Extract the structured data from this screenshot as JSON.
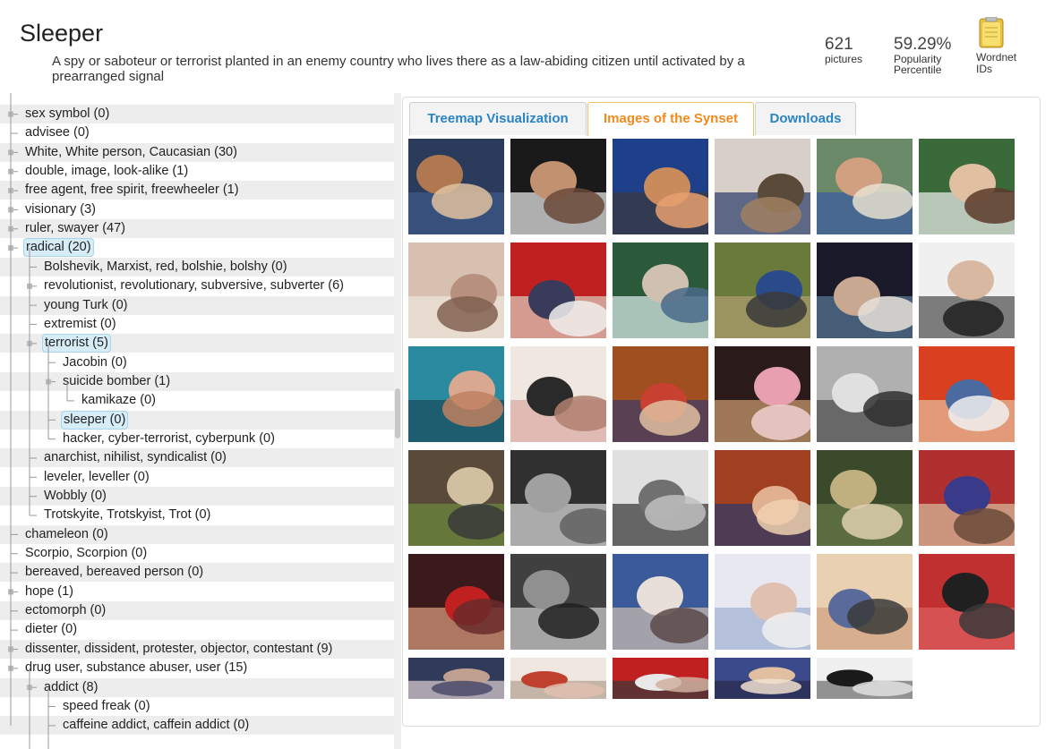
{
  "header": {
    "title": "Sleeper",
    "gloss": "A spy or saboteur or terrorist planted in an enemy country who lives there as a law-abiding citizen until activated by a prearranged signal",
    "pictures_count": "621",
    "pictures_label": "pictures",
    "popularity_value": "59.29%",
    "popularity_label_1": "Popularity",
    "popularity_label_2": "Percentile",
    "wordnet_label_1": "Wordnet",
    "wordnet_label_2": "IDs"
  },
  "tree": {
    "items": [
      {
        "label": "sex symbol (0)",
        "depth": 0,
        "selected": false,
        "expandable": true
      },
      {
        "label": "advisee (0)",
        "depth": 0,
        "selected": false,
        "expandable": false
      },
      {
        "label": "White, White person, Caucasian (30)",
        "depth": 0,
        "selected": false,
        "expandable": true
      },
      {
        "label": "double, image, look-alike (1)",
        "depth": 0,
        "selected": false,
        "expandable": true
      },
      {
        "label": "free agent, free spirit, freewheeler (1)",
        "depth": 0,
        "selected": false,
        "expandable": true
      },
      {
        "label": "visionary (3)",
        "depth": 0,
        "selected": false,
        "expandable": true
      },
      {
        "label": "ruler, swayer (47)",
        "depth": 0,
        "selected": false,
        "expandable": true
      },
      {
        "label": "radical (20)",
        "depth": 0,
        "selected": true,
        "expandable": true
      },
      {
        "label": "Bolshevik, Marxist, red, bolshie, bolshy (0)",
        "depth": 1,
        "selected": false,
        "expandable": false
      },
      {
        "label": "revolutionist, revolutionary, subversive, subverter (6)",
        "depth": 1,
        "selected": false,
        "expandable": true
      },
      {
        "label": "young Turk (0)",
        "depth": 1,
        "selected": false,
        "expandable": false
      },
      {
        "label": "extremist (0)",
        "depth": 1,
        "selected": false,
        "expandable": false
      },
      {
        "label": "terrorist (5)",
        "depth": 1,
        "selected": true,
        "expandable": true
      },
      {
        "label": "Jacobin (0)",
        "depth": 2,
        "selected": false,
        "expandable": false
      },
      {
        "label": "suicide bomber (1)",
        "depth": 2,
        "selected": false,
        "expandable": true
      },
      {
        "label": "kamikaze (0)",
        "depth": 3,
        "selected": false,
        "expandable": false
      },
      {
        "label": "sleeper (0)",
        "depth": 2,
        "selected": true,
        "expandable": false
      },
      {
        "label": "hacker, cyber-terrorist, cyberpunk (0)",
        "depth": 2,
        "selected": false,
        "expandable": false
      },
      {
        "label": "anarchist, nihilist, syndicalist (0)",
        "depth": 1,
        "selected": false,
        "expandable": false
      },
      {
        "label": "leveler, leveller (0)",
        "depth": 1,
        "selected": false,
        "expandable": false
      },
      {
        "label": "Wobbly (0)",
        "depth": 1,
        "selected": false,
        "expandable": false
      },
      {
        "label": "Trotskyite, Trotskyist, Trot (0)",
        "depth": 1,
        "selected": false,
        "expandable": false
      },
      {
        "label": "chameleon (0)",
        "depth": 0,
        "selected": false,
        "expandable": false
      },
      {
        "label": "Scorpio, Scorpion (0)",
        "depth": 0,
        "selected": false,
        "expandable": false
      },
      {
        "label": "bereaved, bereaved person (0)",
        "depth": 0,
        "selected": false,
        "expandable": false
      },
      {
        "label": "hope (1)",
        "depth": 0,
        "selected": false,
        "expandable": true
      },
      {
        "label": "ectomorph (0)",
        "depth": 0,
        "selected": false,
        "expandable": false
      },
      {
        "label": "dieter (0)",
        "depth": 0,
        "selected": false,
        "expandable": false
      },
      {
        "label": "dissenter, dissident, protester, objector, contestant (9)",
        "depth": 0,
        "selected": false,
        "expandable": true
      },
      {
        "label": "drug user, substance abuser, user (15)",
        "depth": 0,
        "selected": false,
        "expandable": true
      },
      {
        "label": "addict (8)",
        "depth": 1,
        "selected": false,
        "expandable": true
      },
      {
        "label": "speed freak (0)",
        "depth": 2,
        "selected": false,
        "expandable": false
      },
      {
        "label": "caffeine addict, caffein addict (0)",
        "depth": 2,
        "selected": false,
        "expandable": false
      }
    ]
  },
  "tabs": [
    {
      "label": "Treemap Visualization",
      "active": false
    },
    {
      "label": "Images of the Synset",
      "active": true
    },
    {
      "label": "Downloads",
      "active": false
    }
  ],
  "colors": {
    "tab_link": "#2b84c4",
    "tab_active": "#f08a1c",
    "selected_bg": "#d6ecf7",
    "row_shade": "#ededed"
  },
  "images": [
    {
      "palette": [
        "#2a3b5c",
        "#b07850",
        "#3d5a8a",
        "#e2c2a0"
      ]
    },
    {
      "palette": [
        "#1a1a1a",
        "#c29270",
        "#f0f0f0",
        "#6a4a3a"
      ]
    },
    {
      "palette": [
        "#1e3f8a",
        "#c98a5c",
        "#3a3a3a",
        "#e8a070"
      ]
    },
    {
      "palette": [
        "#d8d0c8",
        "#5a4a3a",
        "#2a3a6a",
        "#a08060"
      ]
    },
    {
      "palette": [
        "#6a8a6a",
        "#d0a080",
        "#3a5aa0",
        "#e8e0d0"
      ]
    },
    {
      "palette": [
        "#3a6a3a",
        "#e0c0a0",
        "#f0f0f0",
        "#5a3a2a"
      ]
    },
    {
      "palette": [
        "#d8c0b0",
        "#b89080",
        "#f0e8e0",
        "#806050"
      ]
    },
    {
      "palette": [
        "#c02020",
        "#3a3a5a",
        "#e0d0c0",
        "#f0f0f0"
      ]
    },
    {
      "palette": [
        "#2a5a3a",
        "#d0c0b0",
        "#e0f0f0",
        "#4a6a8a"
      ]
    },
    {
      "palette": [
        "#6a7a3a",
        "#2a4a8a",
        "#b0a070",
        "#3a3a3a"
      ]
    },
    {
      "palette": [
        "#1a1a2a",
        "#c8a890",
        "#5a7a9a",
        "#e8e0d8"
      ]
    },
    {
      "palette": [
        "#f0f0f0",
        "#d8b8a0",
        "#4a4a4a",
        "#202020"
      ]
    },
    {
      "palette": [
        "#2a8aa0",
        "#d8a890",
        "#1a4a5a",
        "#c08060"
      ]
    },
    {
      "palette": [
        "#f0e8e0",
        "#2a2a2a",
        "#d8a8a0",
        "#b08070"
      ]
    },
    {
      "palette": [
        "#a05020",
        "#c84030",
        "#3a3a6a",
        "#e0c0a0"
      ]
    },
    {
      "palette": [
        "#2a1a1a",
        "#e8a0b0",
        "#d0a070",
        "#f0d0d0"
      ]
    },
    {
      "palette": [
        "#b0b0b0",
        "#e0e0e0",
        "#4a4a4a",
        "#303030"
      ]
    },
    {
      "palette": [
        "#d84020",
        "#4a6aa0",
        "#e8c0a0",
        "#f0f0f0"
      ]
    },
    {
      "palette": [
        "#5a4a3a",
        "#d0c0a0",
        "#6a8a3a",
        "#3a3a3a"
      ]
    },
    {
      "palette": [
        "#303030",
        "#a0a0a0",
        "#e0e0e0",
        "#606060"
      ]
    },
    {
      "palette": [
        "#e0e0e0",
        "#707070",
        "#303030",
        "#c0c0c0"
      ]
    },
    {
      "palette": [
        "#a04020",
        "#e0b090",
        "#2a3a6a",
        "#f0d0b0"
      ]
    },
    {
      "palette": [
        "#3a4a2a",
        "#c0b080",
        "#6a7a4a",
        "#e0d0b0"
      ]
    },
    {
      "palette": [
        "#b03030",
        "#3a3a8a",
        "#d8c0a0",
        "#6a4a3a"
      ]
    },
    {
      "palette": [
        "#3a1a1a",
        "#c02020",
        "#e0a080",
        "#6a2a2a"
      ]
    },
    {
      "palette": [
        "#404040",
        "#909090",
        "#d0d0d0",
        "#202020"
      ]
    },
    {
      "palette": [
        "#3a5a9a",
        "#e8e0d8",
        "#d0c0b0",
        "#5a4a4a"
      ]
    },
    {
      "palette": [
        "#e8e8f0",
        "#e0c0b0",
        "#a0b0d0",
        "#f0f0f0"
      ]
    },
    {
      "palette": [
        "#e8d0b0",
        "#5a6a9a",
        "#d0a080",
        "#3a3a3a"
      ]
    },
    {
      "palette": [
        "#c03030",
        "#202020",
        "#e06060",
        "#3a3a3a"
      ]
    },
    {
      "palette": [
        "#303a5a",
        "#c0a090",
        "#e0d0d0",
        "#4a4a6a"
      ]
    },
    {
      "palette": [
        "#f0e8e0",
        "#c04030",
        "#b0a090",
        "#e0c0b0"
      ]
    },
    {
      "palette": [
        "#c02020",
        "#e8e8e8",
        "#3a3a3a",
        "#d0b0a0"
      ]
    },
    {
      "palette": [
        "#3a4a8a",
        "#e0c0a0",
        "#2a2a4a",
        "#f0e0d0"
      ]
    },
    {
      "palette": [
        "#f0f0f0",
        "#1a1a1a",
        "#6a6a6a",
        "#e0e0e0"
      ]
    }
  ]
}
